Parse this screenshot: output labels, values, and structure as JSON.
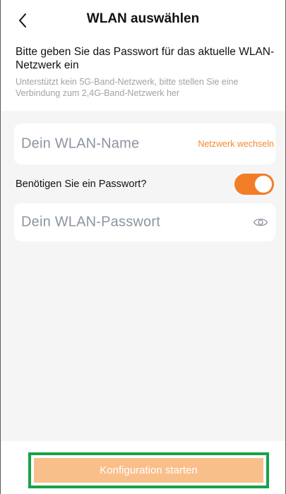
{
  "header": {
    "title": "WLAN auswählen",
    "back_icon": "chevron-left-icon"
  },
  "intro": {
    "main": "Bitte geben Sie das Passwort für das aktuelle WLAN-Netzwerk ein",
    "sub": "Unterstützt kein 5G-Band-Netzwerk, bitte stellen Sie eine Verbindung zum 2,4G-Band-Netzwerk her"
  },
  "wifi": {
    "ssid_placeholder": "Dein WLAN-Name",
    "switch_network_label": "Netzwerk wechseln"
  },
  "password": {
    "question": "Benötigen Sie ein Passwort?",
    "toggle_on": true,
    "placeholder": "Dein WLAN-Passwort",
    "eye_icon": "eye-icon"
  },
  "footer": {
    "start_label": "Konfiguration starten"
  },
  "colors": {
    "accent": "#f27d28",
    "button_disabled": "#f9bf8b",
    "highlight": "#16a34a"
  }
}
